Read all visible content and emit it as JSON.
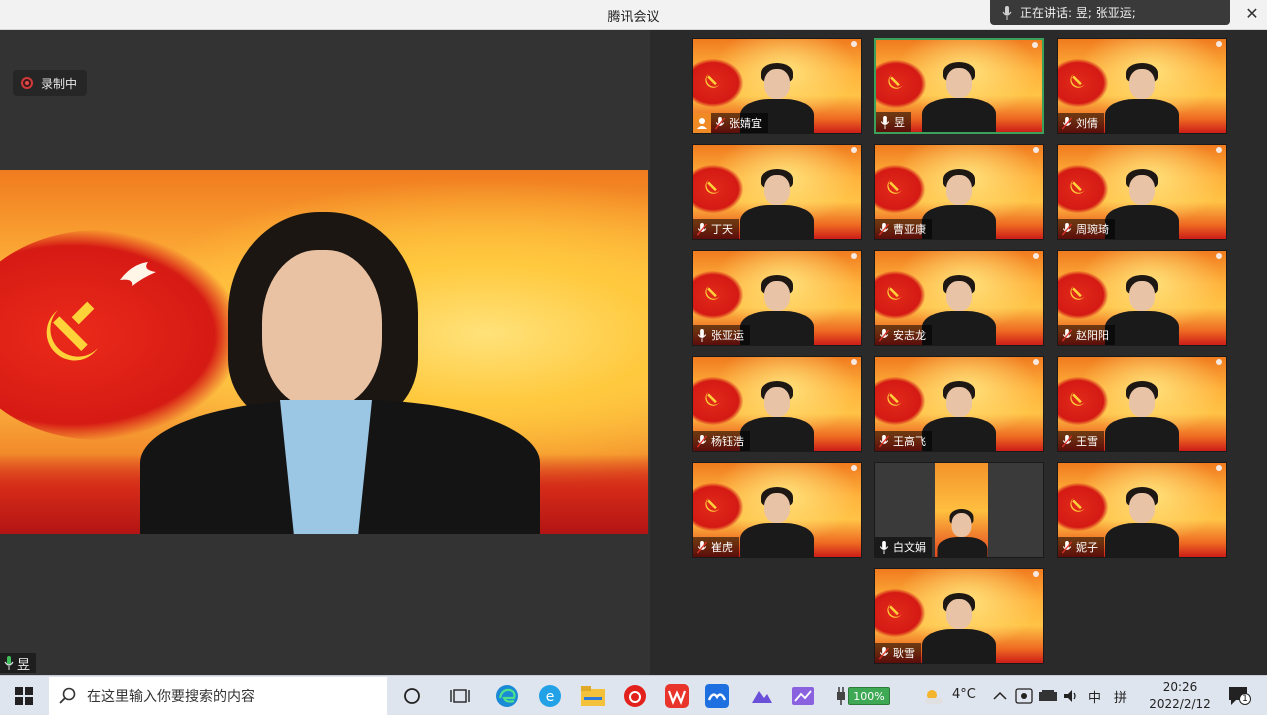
{
  "window": {
    "title": "腾讯会议"
  },
  "speaking": {
    "label": "正在讲话: 昱; 张亚运;"
  },
  "recording": {
    "label": "录制中"
  },
  "self": {
    "name": "昱"
  },
  "participants": [
    {
      "name": "张婧宜",
      "host": true,
      "active": false
    },
    {
      "name": "昱",
      "host": false,
      "active": true
    },
    {
      "name": "刘倩",
      "host": false,
      "active": false
    },
    {
      "name": "丁天",
      "host": false,
      "active": false
    },
    {
      "name": "曹亚康",
      "host": false,
      "active": false
    },
    {
      "name": "周琬琦",
      "host": false,
      "active": false
    },
    {
      "name": "张亚运",
      "host": false,
      "active": false
    },
    {
      "name": "安志龙",
      "host": false,
      "active": false
    },
    {
      "name": "赵阳阳",
      "host": false,
      "active": false
    },
    {
      "name": "杨钰浩",
      "host": false,
      "active": false
    },
    {
      "name": "王高飞",
      "host": false,
      "active": false
    },
    {
      "name": "王雪",
      "host": false,
      "active": false
    },
    {
      "name": "崔虎",
      "host": false,
      "active": false
    },
    {
      "name": "白文娟",
      "host": false,
      "active": false
    },
    {
      "name": "妮子",
      "host": false,
      "active": false
    },
    {
      "name": "耿雪",
      "host": false,
      "active": false
    }
  ],
  "taskbar": {
    "search_placeholder": "在这里输入你要搜索的内容",
    "battery": "100%",
    "weather": "4°C",
    "ime": "中",
    "ime2": "拼",
    "time": "20:26",
    "date": "2022/2/12",
    "notifications": "1"
  }
}
